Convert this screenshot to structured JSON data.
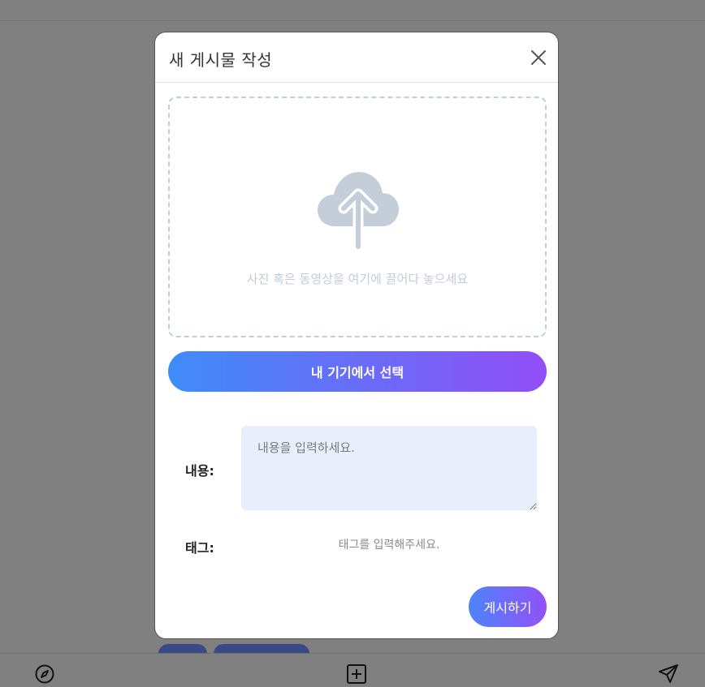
{
  "modal": {
    "title": "새 게시물 작성",
    "dropzone_text": "사진 혹은 동영상을 여기에 끌어다 놓으세요",
    "select_button_label": "내 기기에서 선택",
    "content_label": "내용:",
    "content_placeholder": "내용을 입력하세요.",
    "tag_label": "태그:",
    "tag_placeholder": "태그를 입력해주세요.",
    "post_button_label": "게시하기"
  },
  "bottom_nav": {
    "items": [
      {
        "icon": "compass-icon"
      },
      {
        "icon": "plus-square-icon"
      },
      {
        "icon": "send-icon"
      }
    ]
  },
  "colors": {
    "overlay": "#808080",
    "gradient_start": "#3f8cf9",
    "gradient_end": "#914ef8",
    "textarea_bg": "#e8eefb",
    "upload_icon": "#c4ced9"
  }
}
